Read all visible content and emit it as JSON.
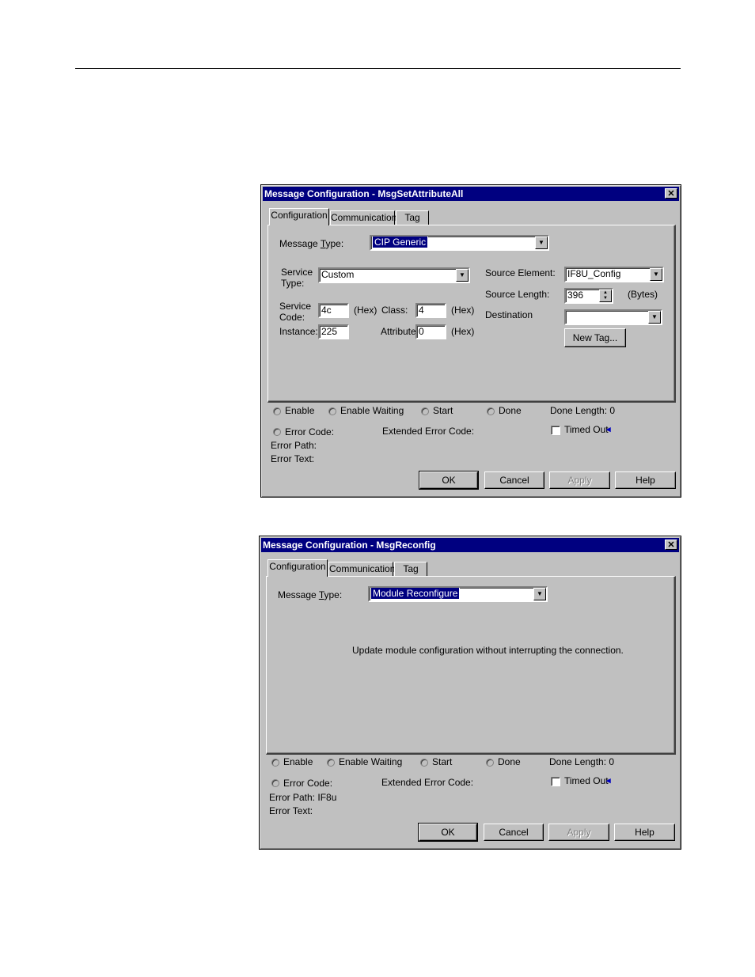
{
  "dialog1": {
    "title": "Message Configuration - MsgSetAttributeAll",
    "tabs": [
      "Configuration",
      "Communication",
      "Tag"
    ],
    "message_type_label_pre": "Message ",
    "message_type_label_key": "T",
    "message_type_label_post": "ype:",
    "message_type_value": "CIP Generic",
    "service_type_label_1": "Service",
    "service_type_label_2": "Type:",
    "service_type_value": "Custom",
    "service_code_label_1": "Service",
    "service_code_label_2": "Code:",
    "service_code_value": "4c",
    "hex_label": "(Hex)",
    "class_label": "Class:",
    "class_value": "4",
    "instance_label": "Instance:",
    "instance_value": "225",
    "attribute_label": "Attribute:",
    "attribute_value": "0",
    "source_element_label": "Source Element:",
    "source_element_value": "IF8U_Config",
    "source_length_label": "Source Length:",
    "source_length_value": "396",
    "bytes_label": "(Bytes)",
    "destination_label": "Destination",
    "destination_value": "",
    "new_tag_label": "New Tag...",
    "status": {
      "enable": "Enable",
      "enable_waiting": "Enable Waiting",
      "start": "Start",
      "done": "Done",
      "done_length": "Done Length:  0",
      "error_code": "Error Code:",
      "extended_error_code": "Extended Error Code:",
      "timed_out": "Timed Out",
      "error_path": "Error Path:",
      "error_text": "Error Text:"
    },
    "buttons": {
      "ok": "OK",
      "cancel": "Cancel",
      "apply": "Apply",
      "help": "Help"
    }
  },
  "dialog2": {
    "title": "Message Configuration - MsgReconfig",
    "tabs": [
      "Configuration",
      "Communication",
      "Tag"
    ],
    "message_type_value": "Module Reconfigure",
    "description": "Update module configuration without interrupting the connection.",
    "status": {
      "enable": "Enable",
      "enable_waiting": "Enable Waiting",
      "start": "Start",
      "done": "Done",
      "done_length": "Done Length:  0",
      "error_code": "Error Code:",
      "extended_error_code": "Extended Error Code:",
      "timed_out": "Timed Out",
      "error_path": "Error Path:  IF8u",
      "error_text": "Error Text:"
    },
    "buttons": {
      "ok": "OK",
      "cancel": "Cancel",
      "apply": "Apply",
      "help": "Help"
    }
  },
  "icons": {
    "close": "close-icon",
    "dropdown": "chevron-down-icon",
    "spinner": "spinner-icon",
    "timed_out_arrow": "arrow-left-icon"
  }
}
